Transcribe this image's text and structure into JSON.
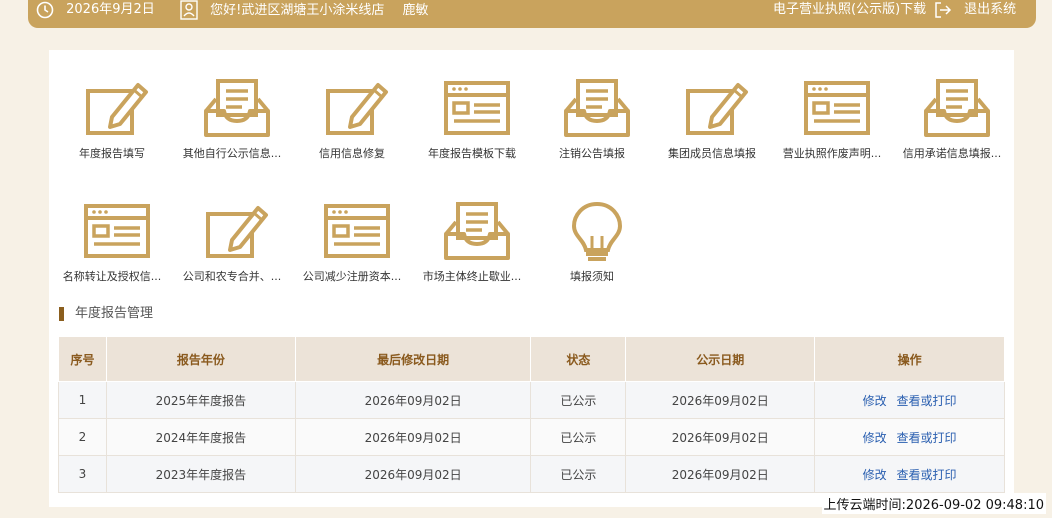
{
  "header": {
    "date": "2026年9月2日",
    "greeting": "您好!武进区湖塘王小涂米线店",
    "username": "鹿敏",
    "license_link": "电子营业执照(公示版)下载",
    "logout": "退出系统"
  },
  "functions": [
    {
      "label": "年度报告填写",
      "icon": "edit-icon"
    },
    {
      "label": "其他自行公示信息...",
      "icon": "inbox-icon"
    },
    {
      "label": "信用信息修复",
      "icon": "edit-icon"
    },
    {
      "label": "年度报告模板下载",
      "icon": "browser-window-icon"
    },
    {
      "label": "注销公告填报",
      "icon": "inbox-icon"
    },
    {
      "label": "集团成员信息填报",
      "icon": "edit-icon"
    },
    {
      "label": "营业执照作废声明...",
      "icon": "browser-window-icon"
    },
    {
      "label": "信用承诺信息填报...",
      "icon": "inbox-icon"
    },
    {
      "label": "名称转让及授权信...",
      "icon": "browser-window-icon"
    },
    {
      "label": "公司和农专合并、...",
      "icon": "edit-icon"
    },
    {
      "label": "公司减少注册资本...",
      "icon": "browser-window-icon"
    },
    {
      "label": "市场主体终止歇业...",
      "icon": "inbox-icon"
    },
    {
      "label": "填报须知",
      "icon": "lightbulb-icon"
    }
  ],
  "section": {
    "title": "年度报告管理"
  },
  "table": {
    "headers": [
      "序号",
      "报告年份",
      "最后修改日期",
      "状态",
      "公示日期",
      "操作"
    ],
    "rows": [
      {
        "no": "1",
        "year": "2025年年度报告",
        "modified": "2026年09月02日",
        "status": "已公示",
        "published": "2026年09月02日",
        "edit": "修改",
        "view": "查看或打印"
      },
      {
        "no": "2",
        "year": "2024年年度报告",
        "modified": "2026年09月02日",
        "status": "已公示",
        "published": "2026年09月02日",
        "edit": "修改",
        "view": "查看或打印"
      },
      {
        "no": "3",
        "year": "2023年年度报告",
        "modified": "2026年09月02日",
        "status": "已公示",
        "published": "2026年09月02日",
        "edit": "修改",
        "view": "查看或打印"
      }
    ]
  },
  "upload_time": "上传云端时间:2026-09-02 09:48:10",
  "colors": {
    "accent": "#c9a35d",
    "icon_gold": "#c9a35d",
    "link": "#2a5fb0",
    "header_text": "#8a5a1e"
  }
}
